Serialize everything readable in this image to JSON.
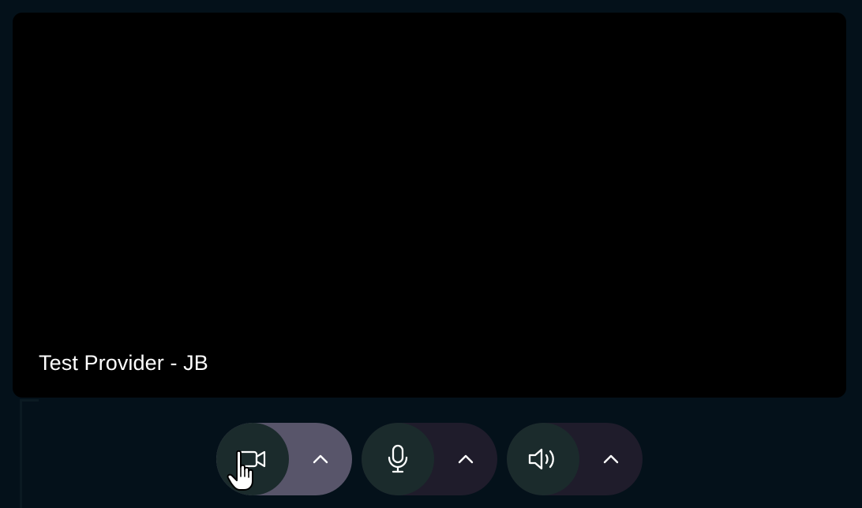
{
  "video": {
    "participant_name": "Test Provider - JB",
    "tile_color": "#000000"
  },
  "controls": {
    "camera": {
      "icon": "video-camera-icon",
      "menu_icon": "chevron-up-icon",
      "active": true
    },
    "microphone": {
      "icon": "microphone-icon",
      "menu_icon": "chevron-up-icon",
      "active": false
    },
    "speaker": {
      "icon": "speaker-icon",
      "menu_icon": "chevron-up-icon",
      "active": false
    }
  },
  "cursor": {
    "icon": "hand-pointer-icon"
  },
  "colors": {
    "page_background": "#04111a",
    "control_background": "#1f1c2b",
    "control_active_background": "#58556a",
    "button_background": "#1b2b2c",
    "icon_color": "#ffffff"
  }
}
